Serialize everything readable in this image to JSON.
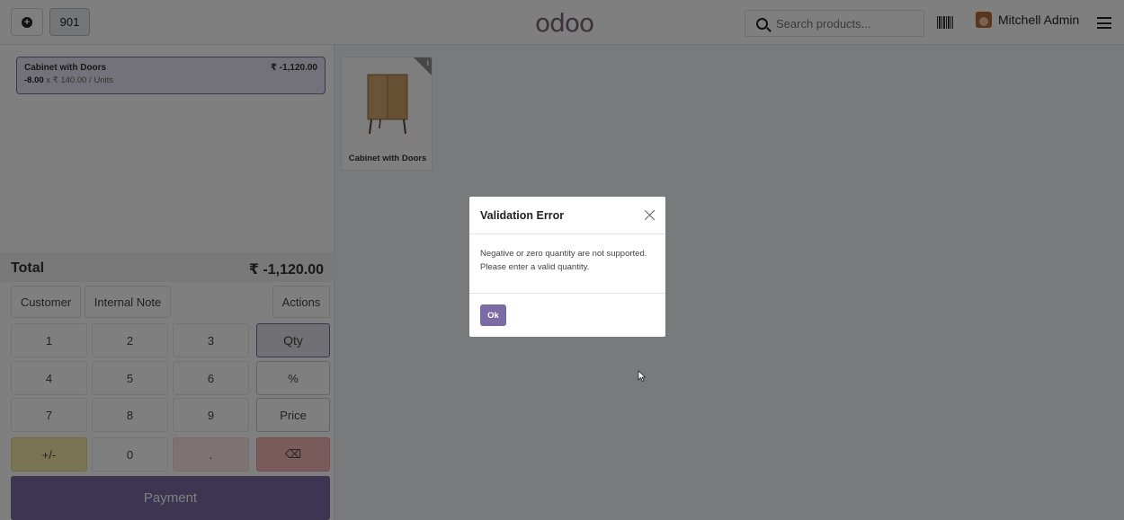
{
  "topbar": {
    "plus_icon": "plus-circle-icon",
    "order_number": "901",
    "logo": "odoo",
    "search_placeholder": "Search products...",
    "barcode_icon": "barcode-icon",
    "user_name": "Mitchell Admin",
    "menu_icon": "hamburger-icon"
  },
  "order": {
    "lines": [
      {
        "name": "Cabinet with Doors",
        "price": "₹ -1,120.00",
        "qty": "-8.00",
        "unit_detail": "x ₹ 140.00 / Units"
      }
    ],
    "total_label": "Total",
    "total_value": "₹ -1,120.00"
  },
  "controls": {
    "customer": "Customer",
    "internal_note": "Internal Note",
    "actions": "Actions"
  },
  "numpad": {
    "k1": "1",
    "k2": "2",
    "k3": "3",
    "k4": "4",
    "k5": "5",
    "k6": "6",
    "k7": "7",
    "k8": "8",
    "k9": "9",
    "sign": "+/-",
    "k0": "0",
    "dot": ".",
    "qty": "Qty",
    "percent": "%",
    "price": "Price",
    "backspace": "⌫"
  },
  "payment_label": "Payment",
  "products": [
    {
      "name": "Cabinet with Doors",
      "info_badge": "i"
    }
  ],
  "modal": {
    "title": "Validation Error",
    "body": "Negative or zero quantity are not supported. Please enter a valid quantity.",
    "ok_label": "Ok"
  },
  "colors": {
    "primary": "#7b6aa3",
    "sign_key": "#f4e9a9",
    "backspace_key": "#f5b7b9"
  }
}
